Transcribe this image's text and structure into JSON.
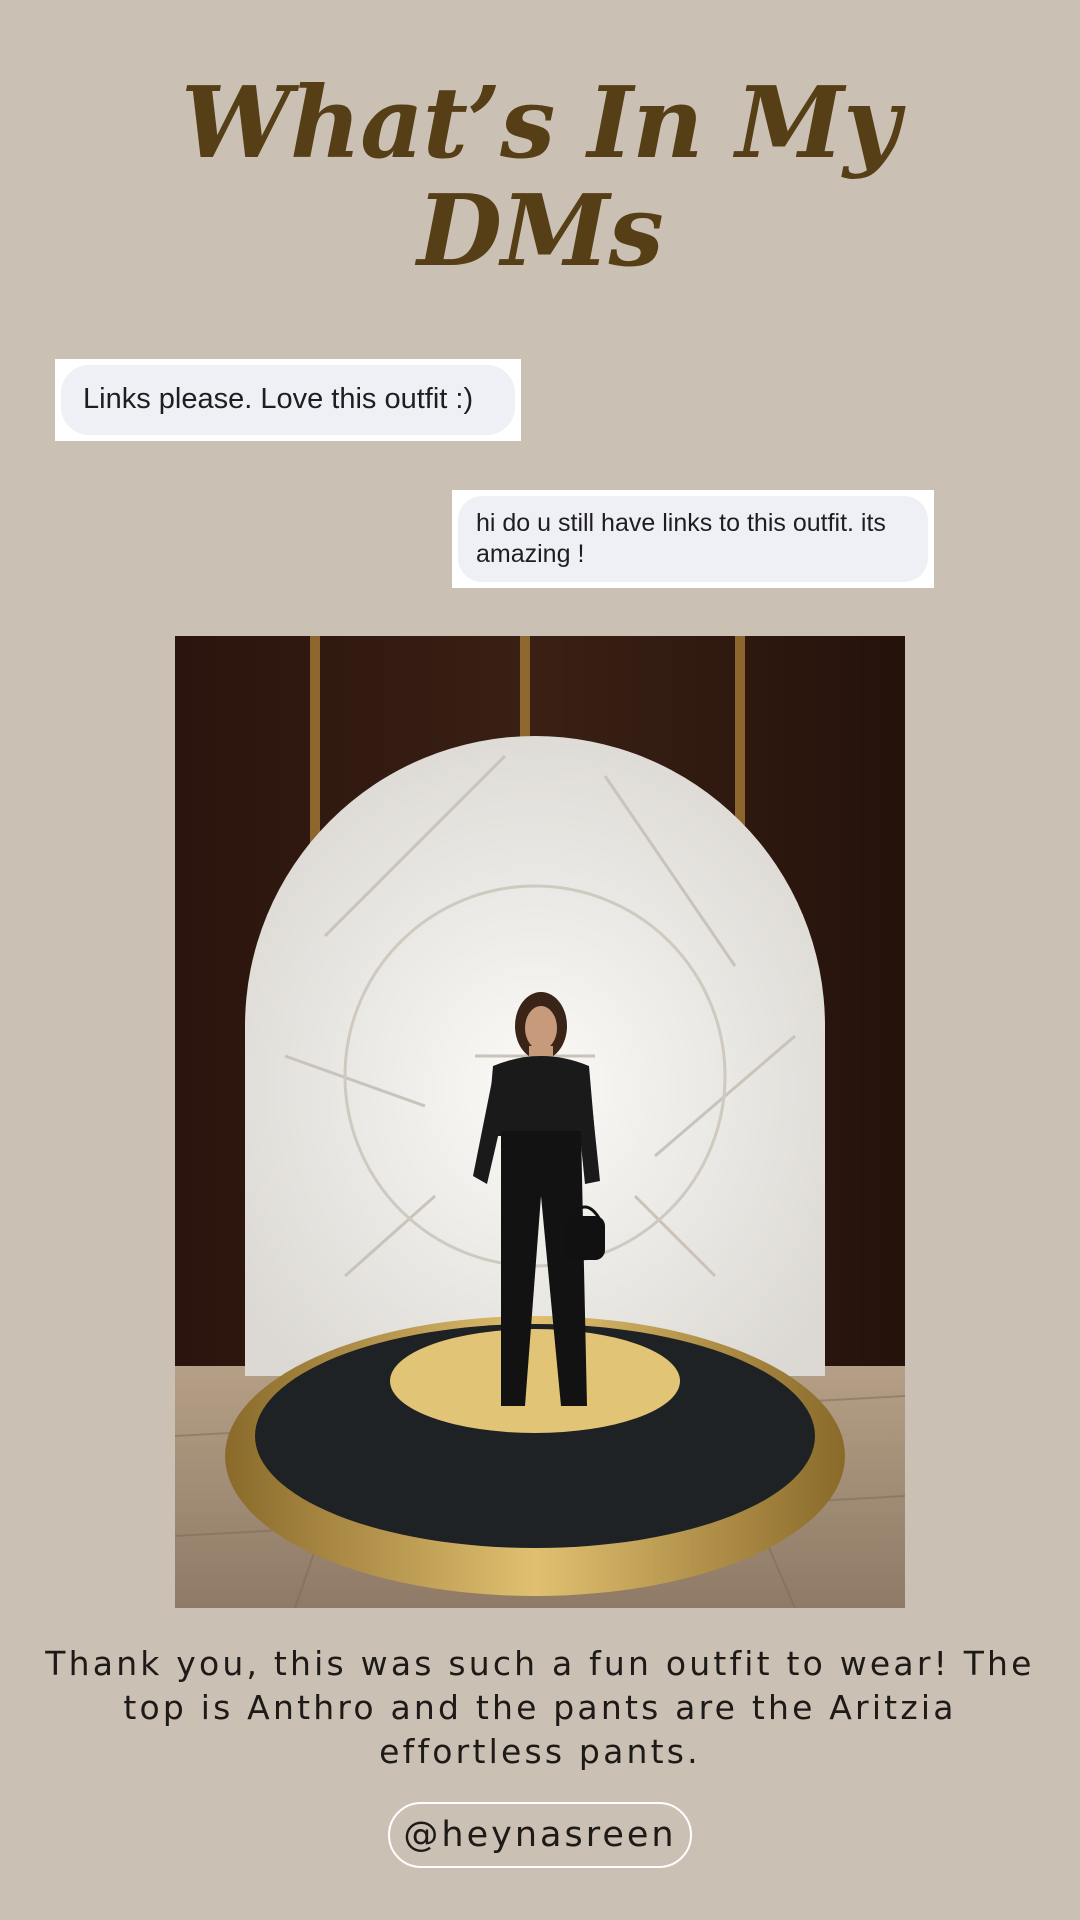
{
  "header": {
    "title_line1": "What’s In My",
    "title_line2": "DMs"
  },
  "messages": [
    {
      "text": "Links please. Love this outfit :)"
    },
    {
      "text": "hi do u still have links to this outfit. its amazing !"
    }
  ],
  "photo": {
    "description_icon": "outfit-photo"
  },
  "caption": {
    "text": "Thank you, this was such a fun outfit to wear! The top is Anthro and the pants are the Aritzia effortless pants."
  },
  "handle": {
    "text": "@heynasreen"
  },
  "colors": {
    "background": "#cbc0b4",
    "title": "#563f16",
    "bubble": "#eff0f5",
    "gold": "#c9a34a"
  }
}
